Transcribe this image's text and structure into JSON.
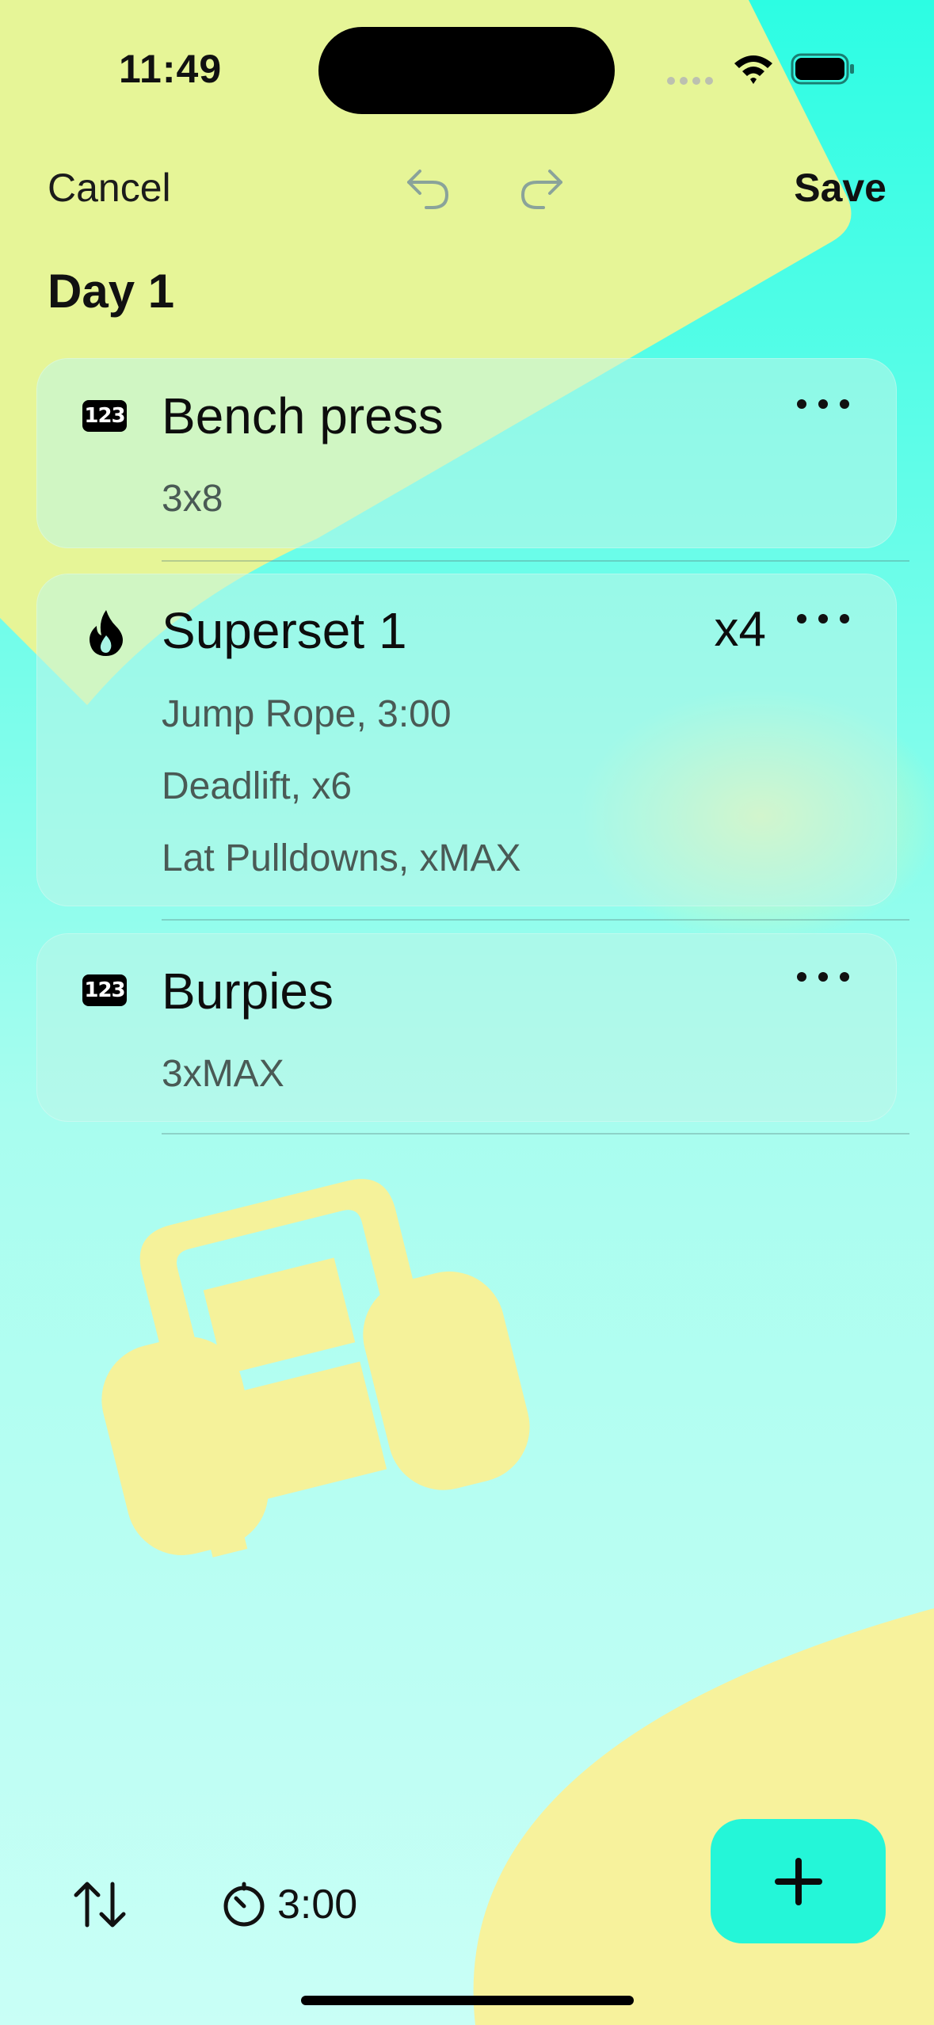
{
  "status_bar": {
    "time": "11:49"
  },
  "nav": {
    "cancel_label": "Cancel",
    "save_label": "Save"
  },
  "page": {
    "title": "Day 1"
  },
  "exercises": [
    {
      "icon": "123",
      "title": "Bench press",
      "details": [
        "3x8"
      ]
    },
    {
      "icon": "flame-icon",
      "title": "Superset 1",
      "multiplier": "x4",
      "details": [
        "Jump Rope,  3:00",
        "Deadlift,  x6",
        "Lat Pulldowns,  xMAX"
      ]
    },
    {
      "icon": "123",
      "title": "Burpies",
      "details": [
        "3xMAX"
      ]
    }
  ],
  "bottom_bar": {
    "timer": "3:00"
  },
  "colors": {
    "accent": "#24f6d8",
    "yellow": "#f5f09a",
    "background_teal": "#4ffce6"
  }
}
